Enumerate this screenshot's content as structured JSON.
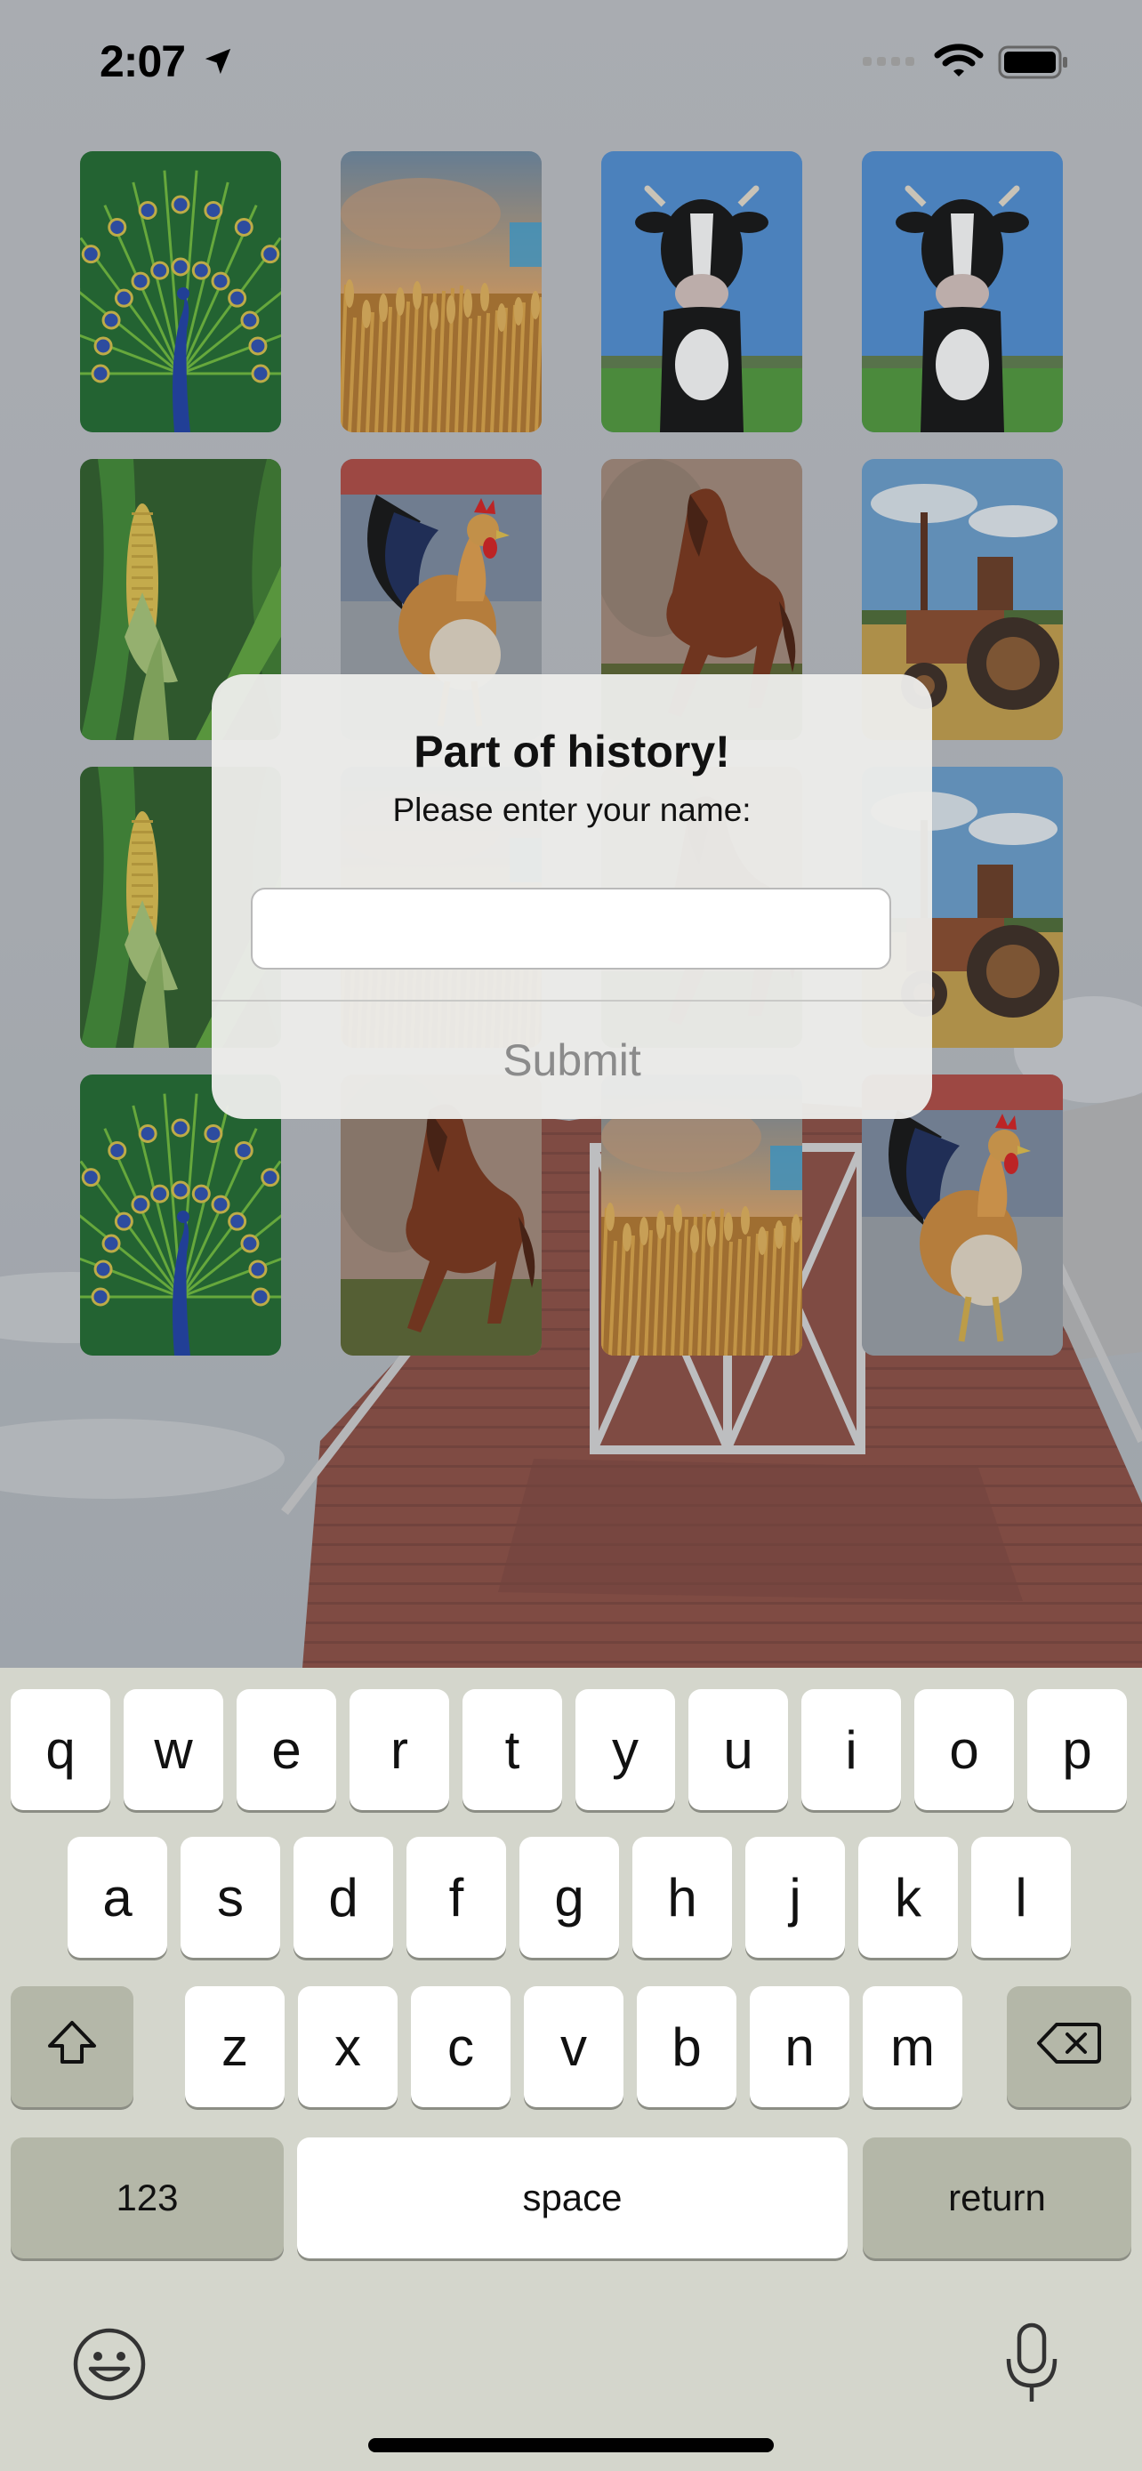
{
  "status_bar": {
    "time": "2:07",
    "icons": [
      "location-arrow-icon",
      "cellular-signal-icon",
      "wifi-icon",
      "battery-icon"
    ]
  },
  "grid": {
    "cards": [
      {
        "image": "peacock"
      },
      {
        "image": "wheat"
      },
      {
        "image": "cow"
      },
      {
        "image": "cow"
      },
      {
        "image": "corn"
      },
      {
        "image": "rooster"
      },
      {
        "image": "horse"
      },
      {
        "image": "tractor"
      },
      {
        "image": "corn"
      },
      {
        "image": "wheat"
      },
      {
        "image": "horse"
      },
      {
        "image": "tractor"
      },
      {
        "image": "peacock"
      },
      {
        "image": "horse"
      },
      {
        "image": "wheat"
      },
      {
        "image": "rooster"
      }
    ]
  },
  "alert": {
    "title": "Part of history!",
    "message": "Please enter your name:",
    "field_value": "",
    "field_placeholder": "",
    "submit_label": "Submit"
  },
  "keyboard": {
    "row1": [
      "q",
      "w",
      "e",
      "r",
      "t",
      "y",
      "u",
      "i",
      "o",
      "p"
    ],
    "row2": [
      "a",
      "s",
      "d",
      "f",
      "g",
      "h",
      "j",
      "k",
      "l"
    ],
    "row3": [
      "z",
      "x",
      "c",
      "v",
      "b",
      "n",
      "m"
    ],
    "numbers_label": "123",
    "space_label": "space",
    "return_label": "return",
    "icons": [
      "shift-icon",
      "delete-icon",
      "emoji-icon",
      "microphone-icon"
    ]
  },
  "colors": {
    "alert_background": "#ececea",
    "keyboard_background": "#d4d6cc",
    "submit_disabled": "#8b8b8b",
    "barn_red": "#8e4436"
  }
}
